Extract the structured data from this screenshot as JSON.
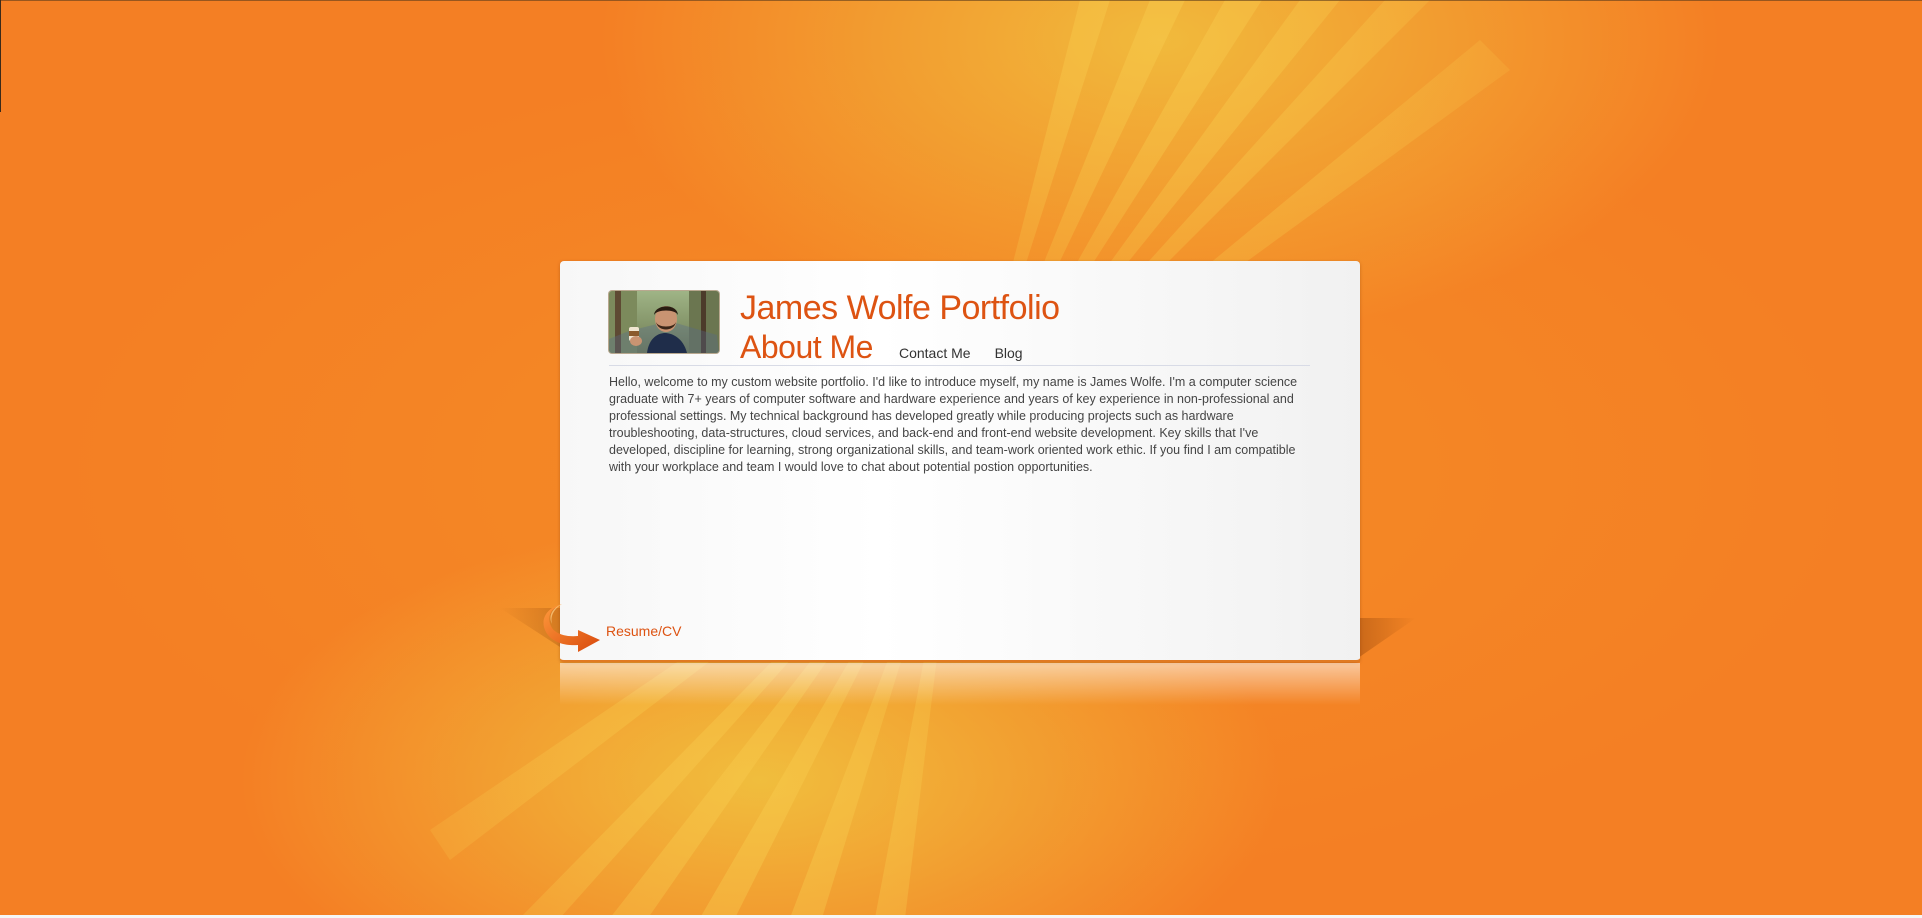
{
  "header": {
    "site_title": "James Wolfe Portfolio"
  },
  "nav": {
    "current": "About Me",
    "links": [
      "Contact Me",
      "Blog"
    ]
  },
  "about": {
    "text": "Hello, welcome to my custom website portfolio. I'd like to introduce myself, my name is James Wolfe. I'm a computer science graduate with 7+ years of computer software and hardware experience and years of key experience in non-professional and professional settings. My technical background has developed greatly while producing projects such as hardware troubleshooting, data-structures, cloud services, and back-end and front-end website development. Key skills that I've developed, discipline for learning, strong organizational skills, and team-work oriented work ethic. If you find I am compatible with your workplace and team I would love to chat about potential postion opportunities."
  },
  "footer": {
    "resume_label": "Resume/CV"
  },
  "colors": {
    "background": "#f47f24",
    "accent": "#dd5312",
    "card": "#ffffff",
    "body_text": "#444444"
  }
}
